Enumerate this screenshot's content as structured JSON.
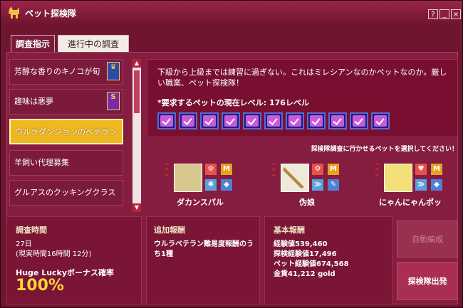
{
  "window": {
    "title": "ペット探検隊",
    "help": "?",
    "minimize": "_",
    "close": "×"
  },
  "tabs": [
    {
      "label": "調査指示"
    },
    {
      "label": "進行中の調査"
    }
  ],
  "missions": [
    {
      "label": "芳醇な香りのキノコが旬",
      "badge": "blue-crown-icon"
    },
    {
      "label": "趣味は悪夢",
      "badge": "purple-s-icon",
      "badge_text": "S"
    },
    {
      "label": "ウルラダンジョンのベテラン",
      "selected": true
    },
    {
      "label": "羊飼い代理募集"
    },
    {
      "label": "グルアスのクッキングクラス"
    }
  ],
  "description": {
    "text": "下級から上級までは練習に過ぎない。これはミレシアンなのかペットなのか。厳しい職業、ペット探検隊！",
    "requirement": "*要求するペットの現在レベル: 176レベル",
    "checks": 11
  },
  "pet_hint": "探検隊調査に行かせるペットを選択してください！",
  "pets": [
    {
      "name": "ダカンスパル",
      "icons": [
        "gear-icon",
        "M",
        "paw-icon",
        "dog-icon"
      ]
    },
    {
      "name": "伪娘",
      "icons": [
        "gear-icon",
        "M",
        "wing-icon",
        "brush-icon"
      ]
    },
    {
      "name": "にゃんにゃんポッ",
      "icons": [
        "heart-icon",
        "M",
        "wing-icon",
        "cat-icon"
      ]
    }
  ],
  "survey": {
    "label": "調査時間",
    "days": "27日",
    "actual": "(現実時間16時間 12分)",
    "bonus_label": "Huge Luckyボーナス確率",
    "bonus_value": "100%"
  },
  "extra_reward": {
    "label": "追加報酬",
    "text": "ウルラベテラン難易度報酬のうち1種"
  },
  "base_reward": {
    "label": "基本報酬",
    "lines": [
      "経験値539,460",
      "探検経験値17,496",
      "ペット経験値674,568",
      "金貨41,212 gold"
    ]
  },
  "buttons": {
    "auto": "自動編成",
    "start": "探検隊出発"
  },
  "colors": {
    "accent": "#f0b820",
    "background": "#851d40",
    "highlight": "#ffd23a"
  }
}
